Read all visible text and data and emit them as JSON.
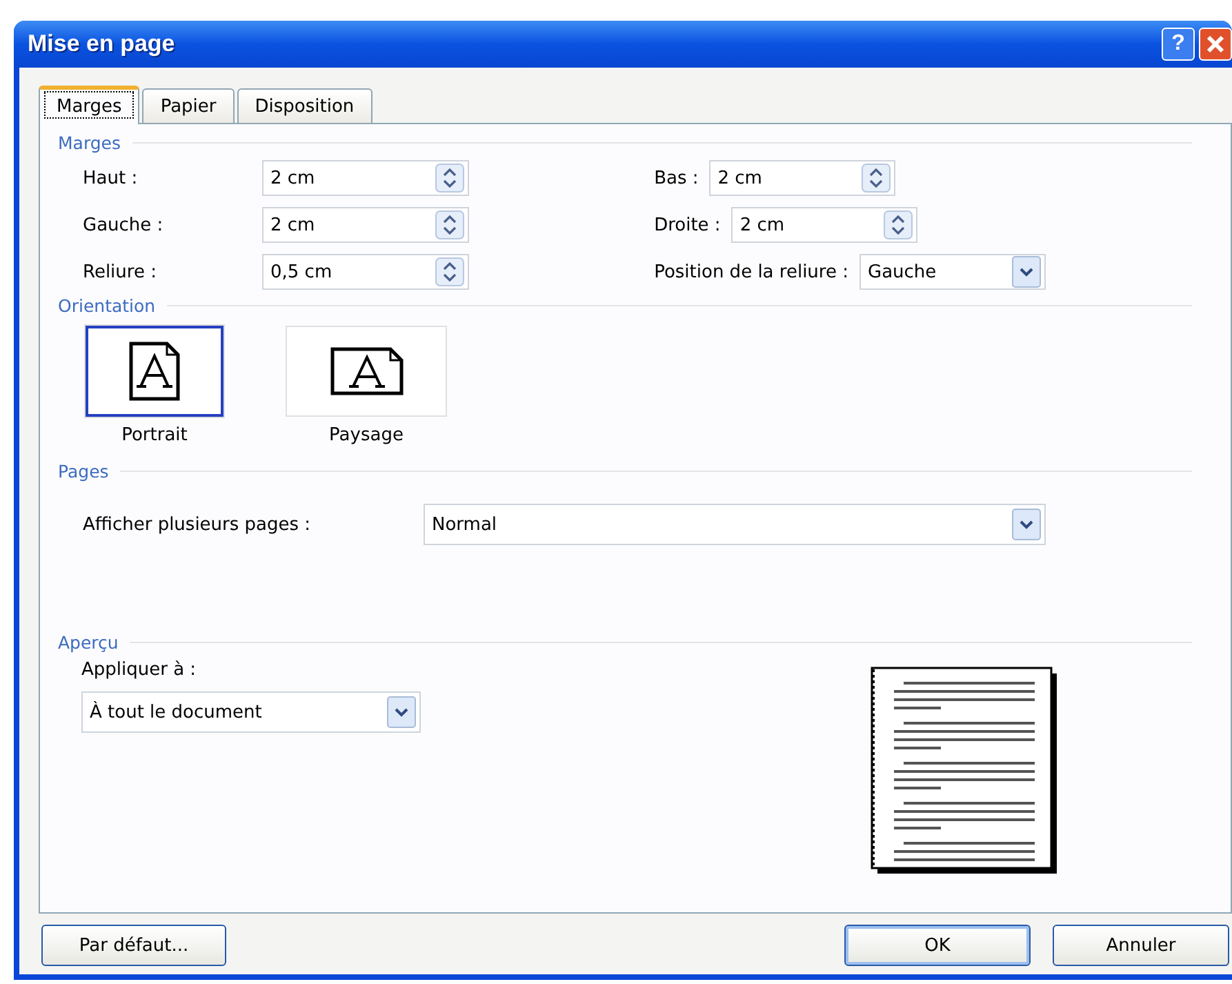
{
  "window": {
    "title": "Mise en page",
    "help_button": "?"
  },
  "tabs": [
    {
      "label": "Marges",
      "selected": true
    },
    {
      "label": "Papier",
      "selected": false
    },
    {
      "label": "Disposition",
      "selected": false
    }
  ],
  "margins": {
    "title": "Marges",
    "left_fields": [
      {
        "label": "Haut :",
        "value": "2 cm",
        "kind": "spin"
      },
      {
        "label": "Gauche :",
        "value": "2 cm",
        "kind": "spin"
      },
      {
        "label": "Reliure :",
        "value": "0,5 cm",
        "kind": "spin"
      }
    ],
    "right_fields": [
      {
        "label": "Bas :",
        "value": "2 cm",
        "kind": "spin"
      },
      {
        "label": "Droite :",
        "value": "2 cm",
        "kind": "spin"
      },
      {
        "label": "Position de la reliure :",
        "value": "Gauche",
        "kind": "select"
      }
    ]
  },
  "orientation": {
    "title": "Orientation",
    "options": [
      {
        "label": "Portrait",
        "kind": "portrait",
        "selected": true
      },
      {
        "label": "Paysage",
        "kind": "landscape",
        "selected": false
      }
    ]
  },
  "pages": {
    "title": "Pages",
    "label": "Afficher plusieurs pages :",
    "value": "Normal"
  },
  "preview": {
    "title": "Aperçu",
    "label": "Appliquer à :",
    "value": "À tout le document"
  },
  "buttons": {
    "default": "Par défaut...",
    "ok": "OK",
    "cancel": "Annuler"
  }
}
